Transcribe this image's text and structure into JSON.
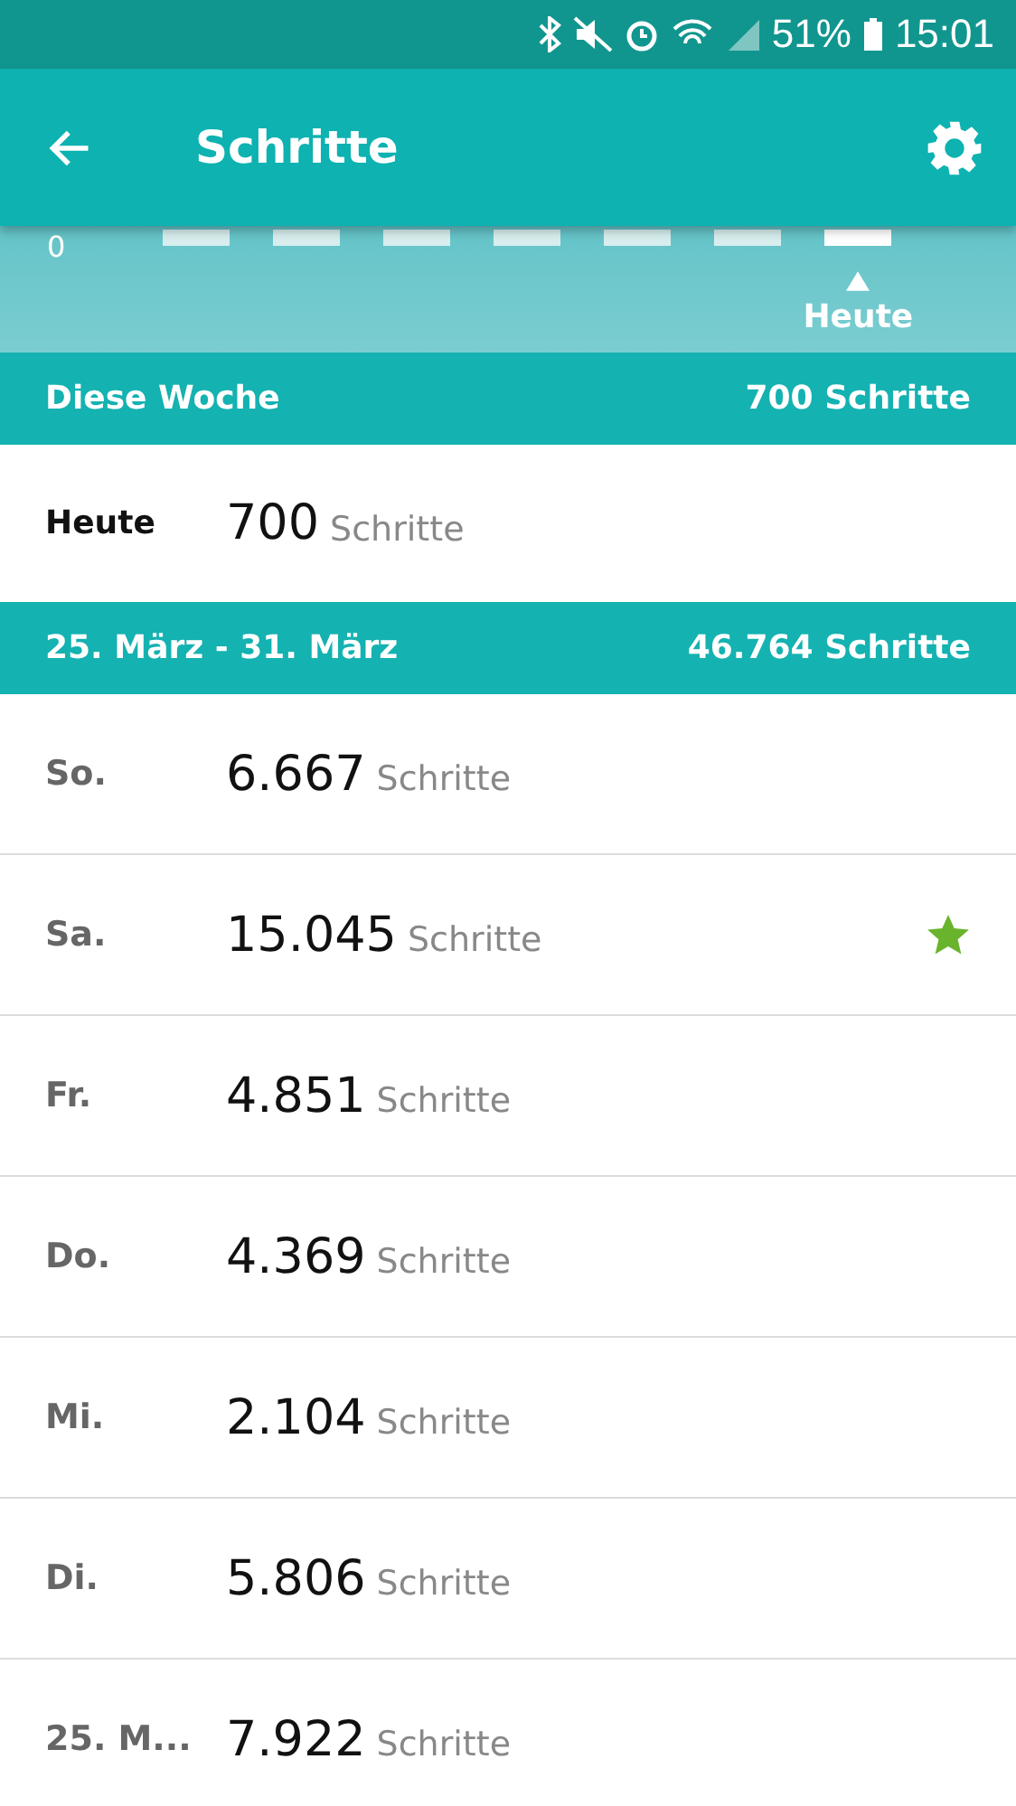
{
  "status_bar": {
    "battery": "51%",
    "time": "15:01"
  },
  "app_bar": {
    "title": "Schritte"
  },
  "chart": {
    "axis_label": "0",
    "bars": [
      {
        "selected": false
      },
      {
        "selected": false
      },
      {
        "selected": false
      },
      {
        "selected": false
      },
      {
        "selected": false
      },
      {
        "selected": false
      },
      {
        "selected": true,
        "label": "Heute"
      }
    ]
  },
  "sections": [
    {
      "title": "Diese Woche",
      "total": "700 Schritte",
      "today": true,
      "rows": [
        {
          "day": "Heute",
          "steps": "700",
          "unit": "Schritte",
          "goal_met": false
        }
      ]
    },
    {
      "title": "25. März - 31. März",
      "total": "46.764 Schritte",
      "today": false,
      "rows": [
        {
          "day": "So.",
          "steps": "6.667",
          "unit": "Schritte",
          "goal_met": false
        },
        {
          "day": "Sa.",
          "steps": "15.045",
          "unit": "Schritte",
          "goal_met": true
        },
        {
          "day": "Fr.",
          "steps": "4.851",
          "unit": "Schritte",
          "goal_met": false
        },
        {
          "day": "Do.",
          "steps": "4.369",
          "unit": "Schritte",
          "goal_met": false
        },
        {
          "day": "Mi.",
          "steps": "2.104",
          "unit": "Schritte",
          "goal_met": false
        },
        {
          "day": "Di.",
          "steps": "5.806",
          "unit": "Schritte",
          "goal_met": false
        },
        {
          "day": "25. M...",
          "steps": "7.922",
          "unit": "Schritte",
          "goal_met": false
        }
      ]
    }
  ]
}
